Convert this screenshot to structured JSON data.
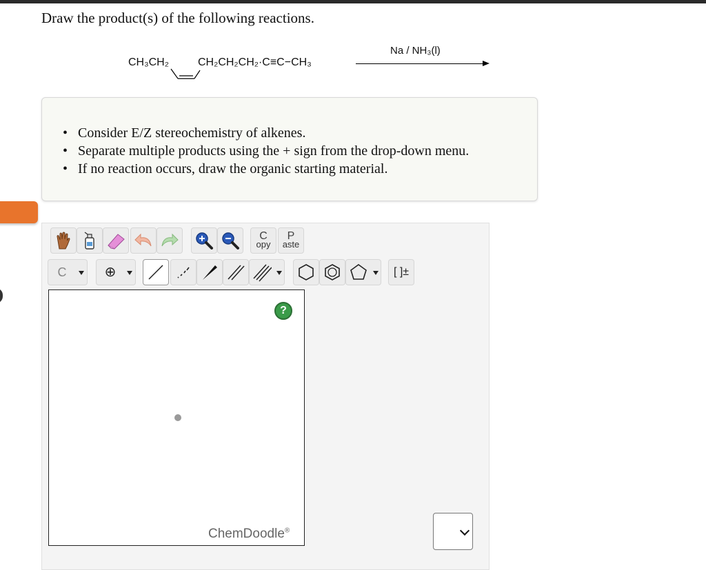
{
  "prompt": "Draw the product(s) of the following reactions.",
  "reaction": {
    "left_group": "CH₃CH₂",
    "right_group": "CH₂CH₂CH₂·C≡C−CH₃",
    "reagent": "Na / NH₃(l)"
  },
  "instructions": [
    "Consider E/Z stereochemistry of alkenes.",
    "Separate multiple products using the + sign from the drop-down menu.",
    "If no reaction occurs, draw the organic starting material."
  ],
  "toolbar": {
    "copy_top": "C",
    "copy_bottom": "opy",
    "paste_top": "P",
    "paste_bottom": "aste",
    "element_label": "C",
    "charge_label": "⊕",
    "bracket_label": "[ ]±"
  },
  "canvas": {
    "help_label": "?",
    "brand": "ChemDoodle",
    "brand_mark": "®"
  },
  "colors": {
    "accent_orange": "#e8742c",
    "help_green": "#3a9b49"
  },
  "icons": [
    "hand-icon",
    "eraser-bottle-icon",
    "eraser-icon",
    "undo-icon",
    "redo-icon",
    "zoom-in-icon",
    "zoom-out-icon",
    "single-bond-icon",
    "dashed-bond-icon",
    "wedge-bond-icon",
    "double-bond-icon",
    "triple-bond-icon",
    "hexagon-icon",
    "benzene-icon",
    "pentagon-icon",
    "chevron-down-icon"
  ]
}
